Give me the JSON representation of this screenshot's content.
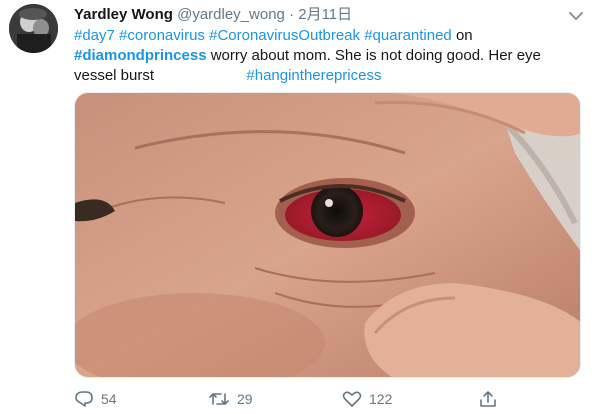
{
  "author": {
    "name": "Yardley Wong",
    "handle": "@yardley_wong",
    "separator": "·",
    "date": "2月11日"
  },
  "tweet": {
    "tag_day7": "#day7",
    "tag_coronavirus": "#coronavirus",
    "tag_outbreak": "#CoronavirusOutbreak",
    "tag_quarantined": "#quarantined",
    "word_on": "on",
    "tag_diamond": "#diamondprincess",
    "body_text": "worry about mom. She is not doing good. Her eye",
    "body_text2": "vessel burst",
    "tag_hang": "#hangintherepricess"
  },
  "stats": {
    "replies": "54",
    "retweets": "29",
    "likes": "122"
  },
  "icons": {
    "reply": "reply-icon",
    "retweet": "retweet-icon",
    "like": "heart-icon",
    "share": "share-icon",
    "menu": "chevron-down-icon"
  },
  "colors": {
    "link": "#1b95e0",
    "muted": "#657786",
    "text": "#14171a"
  }
}
